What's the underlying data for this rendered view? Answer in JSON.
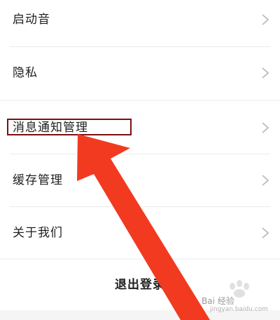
{
  "settings": {
    "items": [
      {
        "label": "启动音"
      },
      {
        "label": "隐私"
      },
      {
        "label": "消息通知管理"
      },
      {
        "label": "缓存管理"
      },
      {
        "label": "关于我们"
      }
    ],
    "logout_label": "退出登录"
  },
  "watermark": {
    "brand": "Bai 经验",
    "url": "jingyan.baidu.com"
  },
  "colors": {
    "background": "#f5f5f5",
    "highlight_border": "#7a1010",
    "arrow": "#f23a21",
    "chevron": "#bdbdbd"
  }
}
